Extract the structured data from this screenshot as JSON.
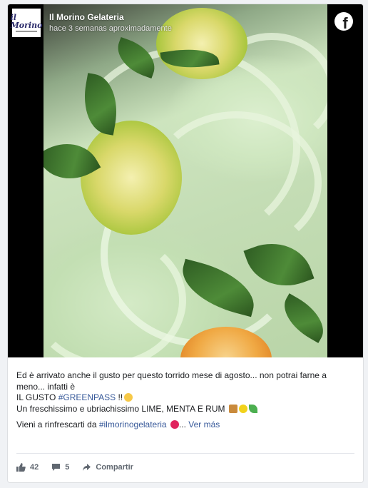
{
  "header": {
    "page_name": "Il Morino Gelateria",
    "timestamp": "hace 3 semanas aproximadamente",
    "logo_text": "il Morino"
  },
  "media": {
    "icons": [
      "facebook-icon"
    ]
  },
  "post": {
    "line1": "Ed è arrivato anche il gusto per questo torrido mese di agosto... non potrai farne a meno... infatti è",
    "line2_prefix": "IL GUSTO ",
    "line2_hashtag": "#GREENPASS",
    "line2_suffix": " !!",
    "line3": "Un freschissimo e ubriachissimo LIME, MENTA E RUM ",
    "line4_prefix": "Vieni a rinfrescarti da ",
    "line4_hashtag": "#ilmorinogelateria",
    "line4_ellipsis": "...",
    "see_more": "Ver más"
  },
  "footer": {
    "likes": "42",
    "comments": "5",
    "share_label": "Compartir"
  },
  "colors": {
    "link": "#365899",
    "text": "#1c1e21",
    "muted": "#606770"
  }
}
